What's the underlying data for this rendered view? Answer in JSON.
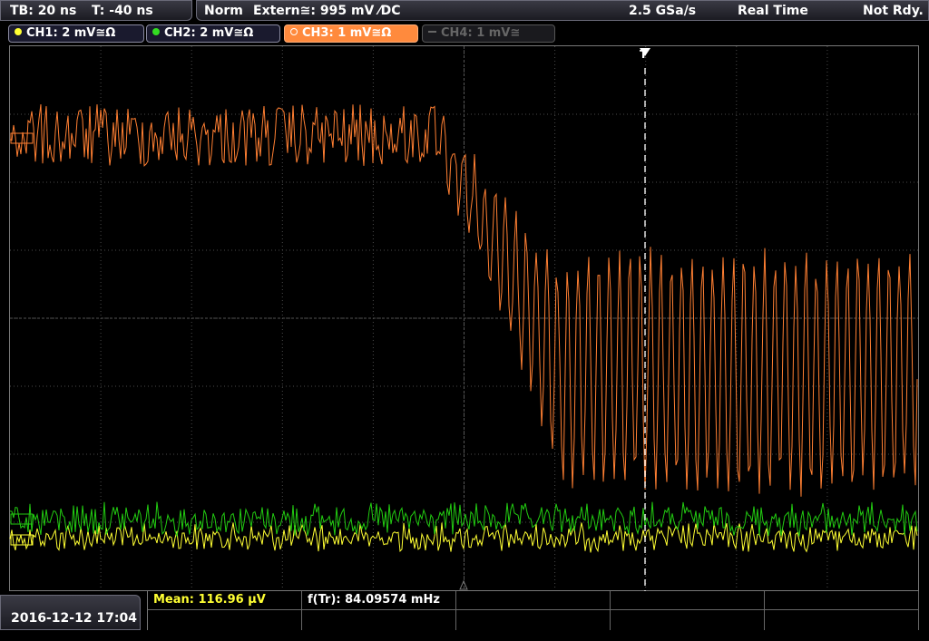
{
  "status": {
    "timebase": "TB: 20 ns",
    "trigger_offset": "T: -40 ns",
    "mode": "Norm",
    "trigger_source": "Extern≅: 995 mV ⁄DC",
    "sample_rate": "2.5 GSa/s",
    "acq_mode": "Real Time",
    "state": "Not Rdy."
  },
  "channels": [
    {
      "label": "CH1: 2 mV≅Ω",
      "color": "#ffff33",
      "active": true
    },
    {
      "label": "CH2: 2 mV≅Ω",
      "color": "#33dd22",
      "active": true
    },
    {
      "label": "CH3: 1 mV≅Ω",
      "color": "#ff8833",
      "active": true,
      "selected": true
    },
    {
      "label": "CH4: 1 mV≅",
      "color": "#777777",
      "active": false
    }
  ],
  "trigger_marker": "T",
  "datetime": "2016-12-12 17:04",
  "measurements": {
    "mean": "Mean: 116.96 µV",
    "freq": "f(Tr): 84.09574 mHz"
  },
  "colors": {
    "ch1": "#ffff33",
    "ch2": "#22cc11",
    "ch3": "#ff7f32",
    "grid": "#555555"
  }
}
